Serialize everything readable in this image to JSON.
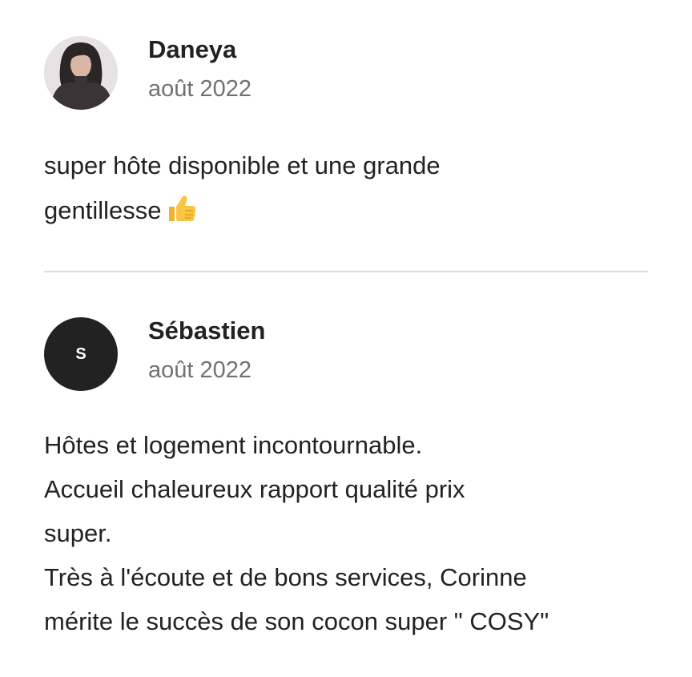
{
  "reviews": [
    {
      "reviewer_name": "Daneya",
      "date": "août 2022",
      "avatar": "photo-avatar",
      "text": "super hôte disponible et une grande\ngentillesse",
      "emoji": "thumbs-up-icon"
    },
    {
      "reviewer_name": "Sébastien",
      "date": "août 2022",
      "avatar_initial": "S",
      "text": "Hôtes et logement incontournable.\nAccueil chaleureux rapport qualité prix\nsuper.\nTrès à l'écoute et de bons services, Corinne\nmérite le succès de son cocon super \" COSY\""
    }
  ],
  "colors": {
    "text": "#222222",
    "muted": "#717171",
    "divider": "#dddddd",
    "avatar_bg": "#222222"
  }
}
